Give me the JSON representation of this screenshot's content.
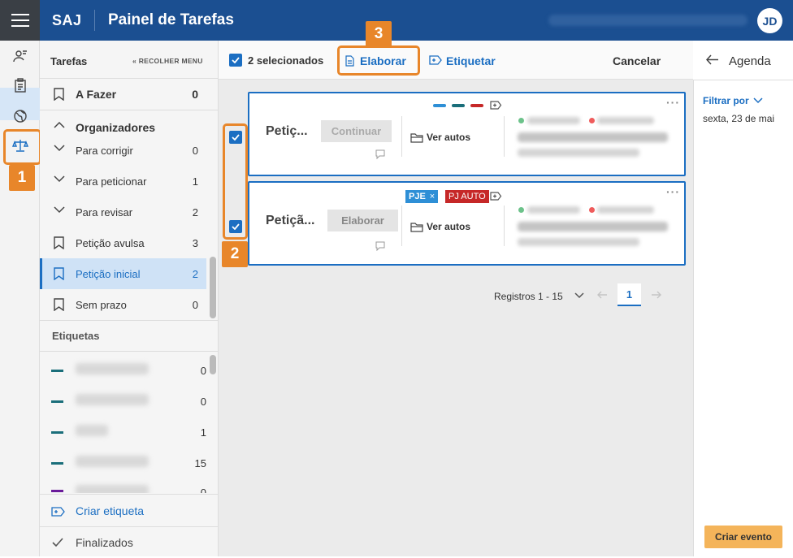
{
  "header": {
    "brand": "SAJ",
    "title": "Painel de Tarefas",
    "avatar_initials": "JD"
  },
  "annotations": {
    "one": "1",
    "two": "2",
    "three": "3"
  },
  "sidebar": {
    "heading": "Tarefas",
    "collapse_label": "RECOLHER MENU",
    "todo": {
      "label": "A Fazer",
      "count": "0"
    },
    "organizers_label": "Organizadores",
    "items": [
      {
        "label": "Para corrigir",
        "count": "0",
        "icon": "chevron-down-icon"
      },
      {
        "label": "Para peticionar",
        "count": "1",
        "icon": "chevron-down-icon"
      },
      {
        "label": "Para revisar",
        "count": "2",
        "icon": "chevron-down-icon"
      },
      {
        "label": "Petição avulsa",
        "count": "3",
        "icon": "bookmark-icon"
      },
      {
        "label": "Petição inicial",
        "count": "2",
        "icon": "bookmark-icon"
      },
      {
        "label": "Sem prazo",
        "count": "0",
        "icon": "bookmark-icon"
      }
    ],
    "tags_heading": "Etiquetas",
    "tags": [
      {
        "count": "0",
        "color": "#1a6e7a"
      },
      {
        "count": "0",
        "color": "#1a6e7a"
      },
      {
        "count": "1",
        "color": "#1a6e7a"
      },
      {
        "count": "15",
        "color": "#1a6e7a"
      },
      {
        "count": "0",
        "color": "#6a1b9a"
      }
    ],
    "create_tag": "Criar etiqueta",
    "finished": "Finalizados"
  },
  "toolbar": {
    "selected": "2 selecionados",
    "elaborate": "Elaborar",
    "tag": "Etiquetar",
    "cancel": "Cancelar"
  },
  "cards": [
    {
      "title": "Petiç...",
      "action": "Continuar",
      "view": "Ver autos",
      "chips": [
        "#2e8fd6",
        "#1a6e7a",
        "#c62828"
      ]
    },
    {
      "title": "Petiçã...",
      "action": "Elaborar",
      "view": "Ver autos",
      "pills": [
        {
          "label": "PJE",
          "color": "#2e8fd6"
        },
        {
          "label": "PJ AUTO",
          "color": "#c62828"
        }
      ]
    }
  ],
  "pagination": {
    "range": "Registros 1 - 15",
    "page": "1"
  },
  "agenda": {
    "title": "Agenda",
    "filter": "Filtrar por",
    "date": "sexta, 23 de mai",
    "create_event": "Criar evento"
  },
  "colors": {
    "brand": "#1b4f91",
    "accent": "#1b6ec2",
    "highlight": "#e8862a"
  }
}
